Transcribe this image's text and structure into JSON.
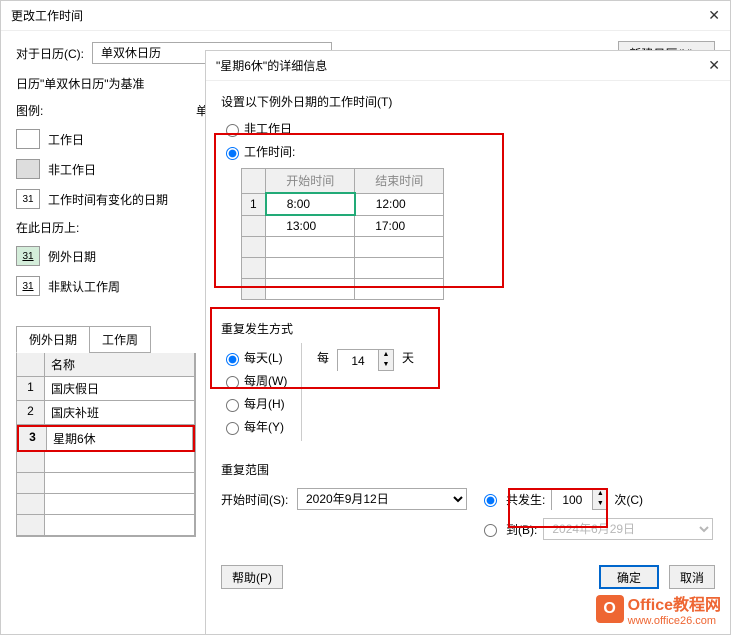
{
  "outer": {
    "title": "更改工作时间",
    "for_calendar_label": "对于日历(C):",
    "calendar_value": "单双休日历",
    "new_calendar_btn": "新建日历(N)...",
    "based_on": "日历\"单双休日历\"为基准",
    "legend_label": "图例:",
    "single_label": "单",
    "legend": {
      "work_day": "工作日",
      "nonwork_day": "非工作日",
      "changed_day": "工作时间有变化的日期",
      "day31": "31"
    },
    "on_this_calendar": "在此日历上:",
    "exception_date": "例外日期",
    "nondefault_week": "非默认工作周",
    "tabs": {
      "exception": "例外日期",
      "workweek": "工作周"
    },
    "table": {
      "name_header": "名称",
      "rows": [
        {
          "num": "1",
          "name": "国庆假日"
        },
        {
          "num": "2",
          "name": "国庆补班"
        },
        {
          "num": "3",
          "name": "星期6休"
        }
      ]
    }
  },
  "inner": {
    "title": "\"星期6休\"的详细信息",
    "set_label": "设置以下例外日期的工作时间(T)",
    "nonworkday": "非工作日",
    "worktime": "工作时间:",
    "time_table": {
      "start_header": "开始时间",
      "end_header": "结束时间",
      "rows": [
        {
          "num": "1",
          "start": "8:00",
          "end": "12:00"
        },
        {
          "num": "",
          "start": "13:00",
          "end": "17:00"
        }
      ]
    },
    "recurrence_label": "重复发生方式",
    "daily": "每天(L)",
    "weekly": "每周(W)",
    "monthly": "每月(H)",
    "yearly": "每年(Y)",
    "every": "每",
    "days": "天",
    "interval_value": "14",
    "range_label": "重复范围",
    "start_label": "开始时间(S):",
    "start_date": "2020年9月12日",
    "occur_label": "共发生:",
    "occur_value": "100",
    "times_label": "次(C)",
    "until_label": "到(B):",
    "until_date": "2024年6月29日",
    "help_btn": "帮助(P)",
    "ok_btn": "确定",
    "cancel_btn": "取消"
  },
  "watermark": {
    "brand": "Office教程网",
    "url": "www.office26.com",
    "logo": "O"
  }
}
